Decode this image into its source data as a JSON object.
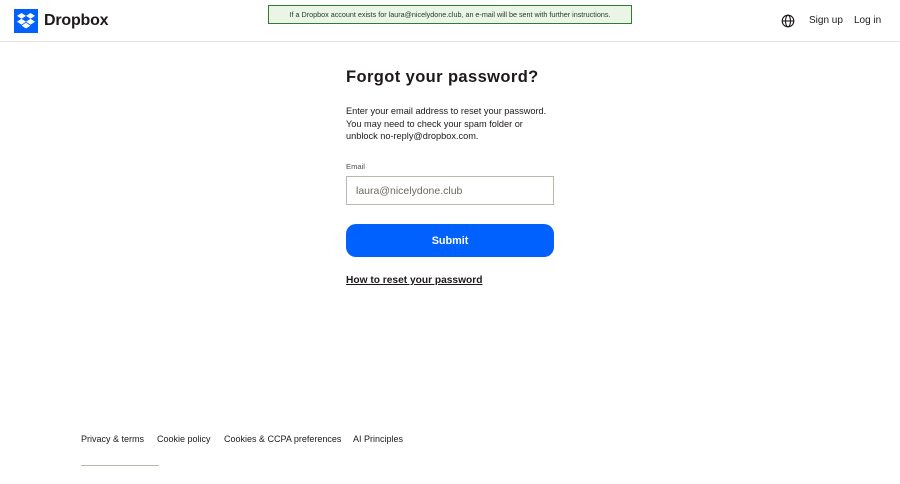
{
  "header": {
    "brand": "Dropbox",
    "banner_text": "If a Dropbox account exists for laura@nicelydone.club, an e-mail will be sent with further instructions.",
    "signup_label": "Sign up",
    "login_label": "Log in"
  },
  "main": {
    "title": "Forgot your password?",
    "description": "Enter your email address to reset your password. You may need to check your spam folder or unblock no-reply@dropbox.com.",
    "email_label": "Email",
    "email_value": "laura@nicelydone.club",
    "submit_label": "Submit",
    "howto_link": "How to reset your password"
  },
  "footer": {
    "links": [
      "Privacy & terms",
      "Cookie policy",
      "Cookies & CCPA preferences",
      "AI Principles"
    ]
  },
  "colors": {
    "accent": "#0061fe",
    "banner_bg": "#eaf5e5",
    "banner_border": "#2e7d32"
  },
  "icons": {
    "logo": "dropbox-logo-icon",
    "language": "globe-icon"
  }
}
